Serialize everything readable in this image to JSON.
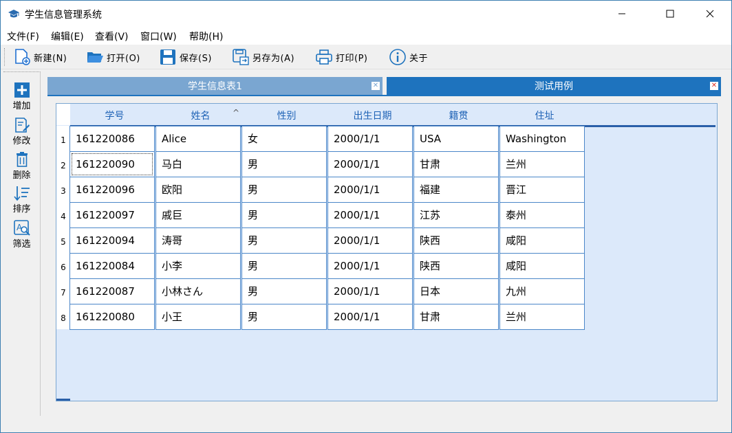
{
  "window": {
    "title": "学生信息管理系统",
    "minimize": "—",
    "maximize": "☐",
    "close": "✕"
  },
  "menu": [
    "文件(F)",
    "编辑(E)",
    "查看(V)",
    "窗口(W)",
    "帮助(H)"
  ],
  "toolbar": [
    {
      "label": "新建(N)",
      "icon": "new-file-icon"
    },
    {
      "label": "打开(O)",
      "icon": "folder-open-icon"
    },
    {
      "label": "保存(S)",
      "icon": "save-icon"
    },
    {
      "label": "另存为(A)",
      "icon": "save-as-icon"
    },
    {
      "label": "打印(P)",
      "icon": "print-icon"
    },
    {
      "label": "关于",
      "icon": "info-icon"
    }
  ],
  "sidebar": [
    {
      "label": "增加",
      "icon": "add-icon"
    },
    {
      "label": "修改",
      "icon": "edit-icon"
    },
    {
      "label": "删除",
      "icon": "delete-icon"
    },
    {
      "label": "排序",
      "icon": "sort-icon"
    },
    {
      "label": "筛选",
      "icon": "filter-icon"
    }
  ],
  "tabs": [
    {
      "label": "学生信息表1",
      "active": false
    },
    {
      "label": "测试用例",
      "active": true
    }
  ],
  "colors": {
    "accent": "#1e73be",
    "tab_inactive": "#7aa6d1",
    "grid_bg": "#dce9fa",
    "header_text": "#1f63b6"
  },
  "table": {
    "columns": [
      "学号",
      "姓名",
      "性别",
      "出生日期",
      "籍贯",
      "住址"
    ],
    "sort_indicator": "^",
    "rows": [
      {
        "num": "1",
        "cells": [
          "161220086",
          "Alice",
          "女",
          "2000/1/1",
          "USA",
          "Washington"
        ]
      },
      {
        "num": "2",
        "cells": [
          "161220090",
          "马白",
          "男",
          "2000/1/1",
          "甘肃",
          "兰州"
        ]
      },
      {
        "num": "3",
        "cells": [
          "161220096",
          "欧阳",
          "男",
          "2000/1/1",
          "福建",
          "晋江"
        ]
      },
      {
        "num": "4",
        "cells": [
          "161220097",
          "戚巨",
          "男",
          "2000/1/1",
          "江苏",
          "泰州"
        ]
      },
      {
        "num": "5",
        "cells": [
          "161220094",
          "涛哥",
          "男",
          "2000/1/1",
          "陕西",
          "咸阳"
        ]
      },
      {
        "num": "6",
        "cells": [
          "161220084",
          "小李",
          "男",
          "2000/1/1",
          "陕西",
          "咸阳"
        ]
      },
      {
        "num": "7",
        "cells": [
          "161220087",
          "小林さん",
          "男",
          "2000/1/1",
          "日本",
          "九州"
        ]
      },
      {
        "num": "8",
        "cells": [
          "161220080",
          "小王",
          "男",
          "2000/1/1",
          "甘肃",
          "兰州"
        ]
      }
    ]
  }
}
